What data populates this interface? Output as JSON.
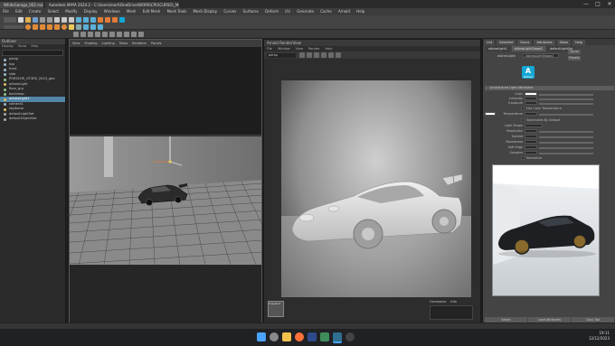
{
  "window": {
    "tabs": [
      {
        "label": "WhiteGarage_002.ma*"
      },
      {
        "label": "Autodesk MAYA 2024.2 - C:\\Users\\mart\\OneDrive\\WORK\\CPU\\CURSO\\_Maya\\scenes\\WhiteGarage\\WhiteGarage_002.ma* --- aiAreaLight1*"
      }
    ],
    "title_short": "Autodesk MAYA 2024.2",
    "minimize": "—",
    "maximize": "□",
    "close": "✕"
  },
  "menubar": {
    "items": [
      "File",
      "Edit",
      "Create",
      "Select",
      "Modify",
      "Display",
      "Windows",
      "Mesh",
      "Edit Mesh",
      "Mesh Tools",
      "Mesh Display",
      "Curves",
      "Surfaces",
      "Deform",
      "UV",
      "Generate",
      "Cache",
      "Arnold",
      "Help"
    ]
  },
  "outliner": {
    "title": "Outliner",
    "menus": [
      "Display",
      "Show",
      "Help"
    ],
    "items": [
      {
        "label": "persp",
        "color": "#9fb8d0"
      },
      {
        "label": "top",
        "color": "#9fb8d0"
      },
      {
        "label": "front",
        "color": "#9fb8d0"
      },
      {
        "label": "side",
        "color": "#9fb8d0"
      },
      {
        "label": "PORSCHE_GT3RS_2023_geo",
        "color": "#8fc48f"
      },
      {
        "label": "aiAreaLight",
        "color": "#e0c060"
      },
      {
        "label": "floor_grp",
        "color": "#8fc48f"
      },
      {
        "label": "backdrop",
        "color": "#8fc48f"
      },
      {
        "label": "aiAreaLight1",
        "color": "#e0c060",
        "selected": true
      },
      {
        "label": "camera1",
        "color": "#9fb8d0"
      },
      {
        "label": "skydome",
        "color": "#e0c060"
      },
      {
        "label": "defaultLightSet",
        "color": "#aaa"
      },
      {
        "label": "defaultObjectSet",
        "color": "#aaa"
      }
    ]
  },
  "viewport": {
    "menus": [
      "View",
      "Shading",
      "Lighting",
      "Show",
      "Renderer",
      "Panels"
    ]
  },
  "render_view": {
    "title": "Arnold RenderView",
    "menus": [
      "File",
      "Window",
      "View",
      "Render",
      "Help"
    ],
    "camera": "persp",
    "snapshot_label": "Snapshot",
    "tabs": [
      "Comments",
      "Info"
    ]
  },
  "attribute_editor": {
    "tabs": [
      "List",
      "Selected",
      "Focus",
      "Attributes",
      "Show",
      "Help"
    ],
    "node_tabs": [
      "aiAreaLight1",
      "aiAreaLightShape1",
      "defaultLightSet"
    ],
    "node_label": "aiAreaLight:",
    "node_value": "aiAreaLightShape1",
    "focus_button": "Focus",
    "presets_button": "Presets",
    "section": "Arnold Area Light Attributes",
    "logo_letter": "A",
    "logo_text": "ARNOLD",
    "attributes": [
      {
        "label": "Color"
      },
      {
        "label": "Intensity"
      },
      {
        "label": "Exposure"
      },
      {
        "label": "Use Color Temperature"
      },
      {
        "label": "Temperature"
      },
      {
        "label": "Illuminates By Default"
      },
      {
        "label": "Light Shape"
      },
      {
        "label": "Resolution"
      },
      {
        "label": "Spread"
      },
      {
        "label": "Roundness"
      },
      {
        "label": "Soft Edge"
      },
      {
        "label": "Samples"
      },
      {
        "label": "Normalize"
      }
    ],
    "footer_buttons": [
      "Select",
      "Load Attributes",
      "Copy Tab"
    ]
  },
  "taskbar": {
    "time": "19:11",
    "date": "12/12/2023"
  },
  "colors": {
    "selection": "#5285a6",
    "arnold_blue": "#14a7d4",
    "maya_accent": "#2f6f8f"
  }
}
